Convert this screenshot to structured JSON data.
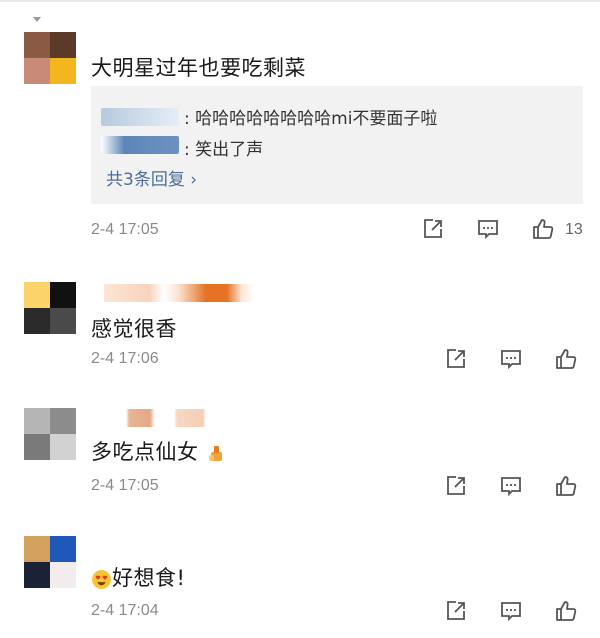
{
  "comments": [
    {
      "text": "大明星过年也要吃剩菜",
      "time": "2-4 17:05",
      "like_count": "13",
      "replies": [
        {
          "text": "哈哈哈哈哈哈哈哈mi不要面子啦"
        },
        {
          "text": "笑出了声"
        }
      ],
      "more_replies": "共3条回复 ›"
    },
    {
      "text": "感觉很香",
      "time": "2-4 17:06"
    },
    {
      "text": "多吃点仙女",
      "time": "2-4 17:05",
      "emoji": "nail-polish-emoji"
    },
    {
      "text": "好想食!",
      "time": "2-4 17:04",
      "emoji": "heart-eyes-emoji"
    }
  ],
  "icons": {
    "share": "share-icon",
    "comment": "comment-icon",
    "like": "like-icon"
  },
  "colors": {
    "link": "#4b6d99",
    "time": "#8a8a8a",
    "reply_bg": "#f2f2f2",
    "icon": "#555555"
  }
}
